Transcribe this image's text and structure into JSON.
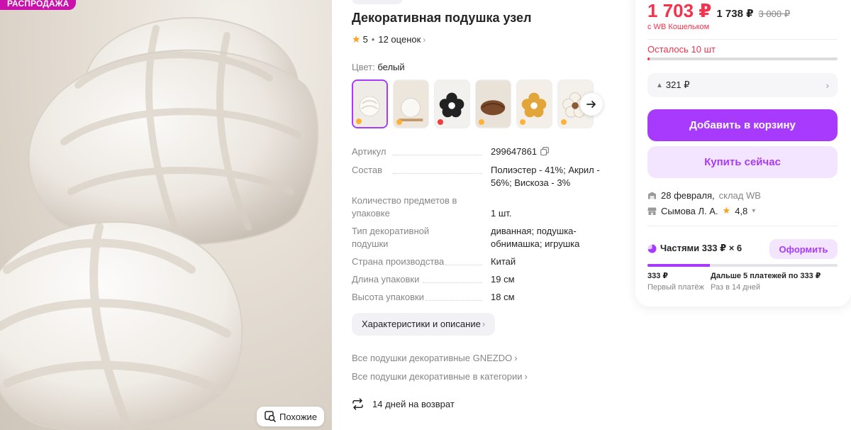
{
  "gallery": {
    "sale_badge": "РАСПРОДАЖА",
    "similar_label": "Похожие"
  },
  "product": {
    "title": "Декоративная подушка узел",
    "rating": "5",
    "reviews": "12 оценок",
    "color_label": "Цвет:",
    "color_value": "белый",
    "specs": [
      {
        "key": "Артикул",
        "value": "299647861"
      },
      {
        "key": "Состав",
        "value": "Полиэстер - 41%; Акрил - 56%; Вискоза - 3%"
      },
      {
        "key": "Количество предметов в упаковке",
        "value": "1 шт."
      },
      {
        "key": "Тип декоративной подушки",
        "value": "диванная; подушка-обнимашка; игрушка"
      },
      {
        "key": "Страна производства",
        "value": "Китай"
      },
      {
        "key": "Длина упаковки",
        "value": "19 см"
      },
      {
        "key": "Высота упаковки",
        "value": "18 см"
      }
    ],
    "chars_button": "Характеристики и описание",
    "brand_link": "Все подушки декоративные GNEZDO",
    "category_link": "Все подушки декоративные в категории",
    "return_text": "14 дней на возврат"
  },
  "buy": {
    "price_main": "1 703 ₽",
    "price_wallet": "1 738 ₽",
    "price_old": "3 000 ₽",
    "wallet_note": "с WB Кошельком",
    "stock_note": "Осталось 10 шт",
    "stock_fraction": 0.01,
    "points": "321 ₽",
    "add_to_cart": "Добавить в корзину",
    "buy_now": "Купить сейчас",
    "delivery_date": "28 февраля,",
    "delivery_place": "склад WB",
    "seller_name": "Сымова Л. А.",
    "seller_rating": "4,8",
    "installments_label": "Частями 333 ₽ × 6",
    "issue_button": "Оформить",
    "installments_progress": 0.33,
    "first_amount": "333 ₽",
    "first_caption": "Первый платёж",
    "rest_amount": "Дальше 5 платежей по 333 ₽",
    "rest_caption": "Раз в 14 дней"
  },
  "colors": {
    "accent": "#a73afd",
    "price_red": "#f5314b",
    "sale_badge": "#cb11ab"
  }
}
